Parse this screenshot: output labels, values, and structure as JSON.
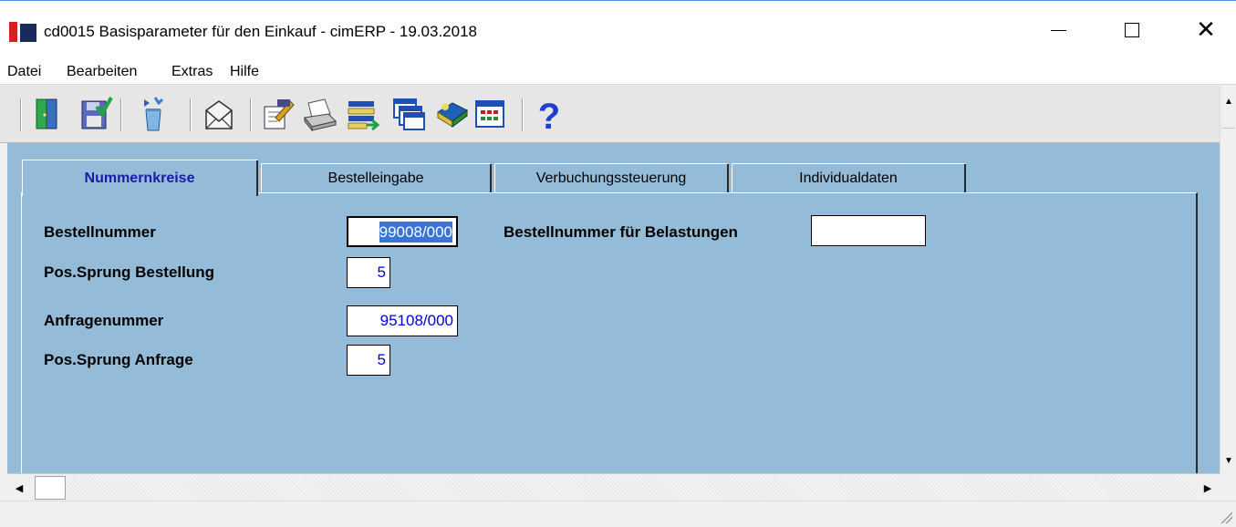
{
  "window": {
    "title": "cd0015 Basisparameter für den Einkauf - cimERP - 19.03.2018",
    "controls": {
      "minimize": "minimize",
      "maximize": "maximize",
      "close": "close"
    }
  },
  "menu": [
    "Datei",
    "Bearbeiten",
    "Extras",
    "Hilfe"
  ],
  "toolbar": {
    "buttons": [
      "exit-door-icon",
      "save-check-icon",
      "recycle-bin-icon",
      "mail-envelope-icon",
      "edit-document-icon",
      "printer-icon",
      "list-transfer-icon",
      "windows-stack-icon",
      "book-icon",
      "calendar-grid-icon",
      "help-question-icon"
    ]
  },
  "tabs": [
    "Nummernkreise",
    "Bestelleingabe",
    "Verbuchungssteuerung",
    "Individualdaten"
  ],
  "active_tab": "Nummernkreise",
  "form": {
    "bestellnummer": {
      "label": "Bestellnummer",
      "value": "99008/000"
    },
    "pos_sprung_bestellung": {
      "label": "Pos.Sprung Bestellung",
      "value": "5"
    },
    "anfragenummer": {
      "label": "Anfragenummer",
      "value": "95108/000"
    },
    "pos_sprung_anfrage": {
      "label": "Pos.Sprung Anfrage",
      "value": "5"
    },
    "bestellnummer_belastungen": {
      "label": "Bestellnummer für Belastungen",
      "value": ""
    }
  },
  "colors": {
    "panel_bg": "#94bcd8",
    "active_tab_text": "#1a1aaa",
    "field_text": "#0000cc",
    "selection": "#3875d7",
    "brand_red": "#d42020"
  }
}
